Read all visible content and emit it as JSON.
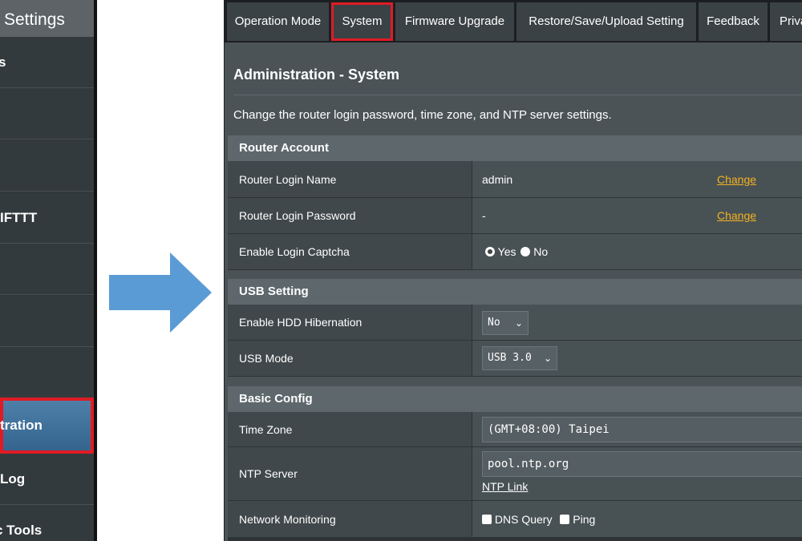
{
  "sidebar": {
    "header": "Settings",
    "items": [
      {
        "label": "s"
      },
      {
        "label": ""
      },
      {
        "label": ""
      },
      {
        "label": "IFTTT"
      },
      {
        "label": ""
      },
      {
        "label": ""
      },
      {
        "label": ""
      },
      {
        "label": "tration"
      },
      {
        "label": "Log"
      },
      {
        "label": "c Tools"
      }
    ]
  },
  "arrow": {
    "color": "#5b9bd5"
  },
  "tabs": [
    {
      "label": "Operation Mode"
    },
    {
      "label": "System"
    },
    {
      "label": "Firmware Upgrade"
    },
    {
      "label": "Restore/Save/Upload Setting"
    },
    {
      "label": "Feedback"
    },
    {
      "label": "Priva"
    }
  ],
  "page": {
    "title": "Administration - System",
    "description": "Change the router login password, time zone, and NTP server settings."
  },
  "router_account": {
    "heading": "Router Account",
    "login_name_label": "Router Login Name",
    "login_name_value": "admin",
    "login_name_change": "Change",
    "login_password_label": "Router Login Password",
    "login_password_value": "-",
    "login_password_change": "Change",
    "captcha_label": "Enable Login Captcha",
    "captcha_yes": "Yes",
    "captcha_no": "No"
  },
  "usb_setting": {
    "heading": "USB Setting",
    "hibernation_label": "Enable HDD Hibernation",
    "hibernation_value": "No",
    "usb_mode_label": "USB Mode",
    "usb_mode_value": "USB 3.0"
  },
  "basic_config": {
    "heading": "Basic Config",
    "time_zone_label": "Time Zone",
    "time_zone_value": "(GMT+08:00) Taipei",
    "ntp_label": "NTP Server",
    "ntp_value": "pool.ntp.org",
    "ntp_link": "NTP Link",
    "monitoring_label": "Network Monitoring",
    "monitoring_dns": "DNS Query",
    "monitoring_ping": "Ping"
  },
  "colors": {
    "highlight": "#e01b24",
    "link": "#f5b321",
    "active_menu": "#4d7fa8"
  }
}
